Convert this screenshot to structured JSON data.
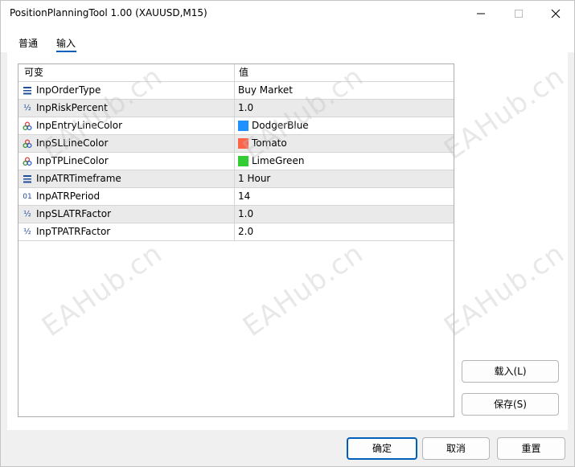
{
  "window": {
    "title": "PositionPlanningTool 1.00 (XAUUSD,M15)"
  },
  "tabs": [
    {
      "label": "普通"
    },
    {
      "label": "输入"
    }
  ],
  "grid": {
    "headers": {
      "variable": "可变",
      "value": "值"
    },
    "rows": [
      {
        "icon": "enum-icon",
        "name": "InpOrderType",
        "value": "Buy Market"
      },
      {
        "icon": "fraction-icon",
        "name": "InpRiskPercent",
        "value": "1.0"
      },
      {
        "icon": "color-icon",
        "name": "InpEntryLineColor",
        "value": "DodgerBlue",
        "swatch": "#1e90ff"
      },
      {
        "icon": "color-icon",
        "name": "InpSLLineColor",
        "value": "Tomato",
        "swatch": "#ff6347"
      },
      {
        "icon": "color-icon",
        "name": "InpTPLineColor",
        "value": "LimeGreen",
        "swatch": "#32cd32"
      },
      {
        "icon": "enum-icon",
        "name": "InpATRTimeframe",
        "value": "1 Hour"
      },
      {
        "icon": "integer-icon",
        "name": "InpATRPeriod",
        "value": "14"
      },
      {
        "icon": "fraction-icon",
        "name": "InpSLATRFactor",
        "value": "1.0"
      },
      {
        "icon": "fraction-icon",
        "name": "InpTPATRFactor",
        "value": "2.0"
      }
    ]
  },
  "buttons": {
    "load": "载入(L)",
    "save": "保存(S)",
    "ok": "确定",
    "cancel": "取消",
    "reset": "重置"
  },
  "icons": {
    "integer_glyph": "01",
    "fraction_glyph": "½"
  },
  "watermark": "EAHub.cn",
  "colors": {
    "accent": "#005fb8"
  }
}
